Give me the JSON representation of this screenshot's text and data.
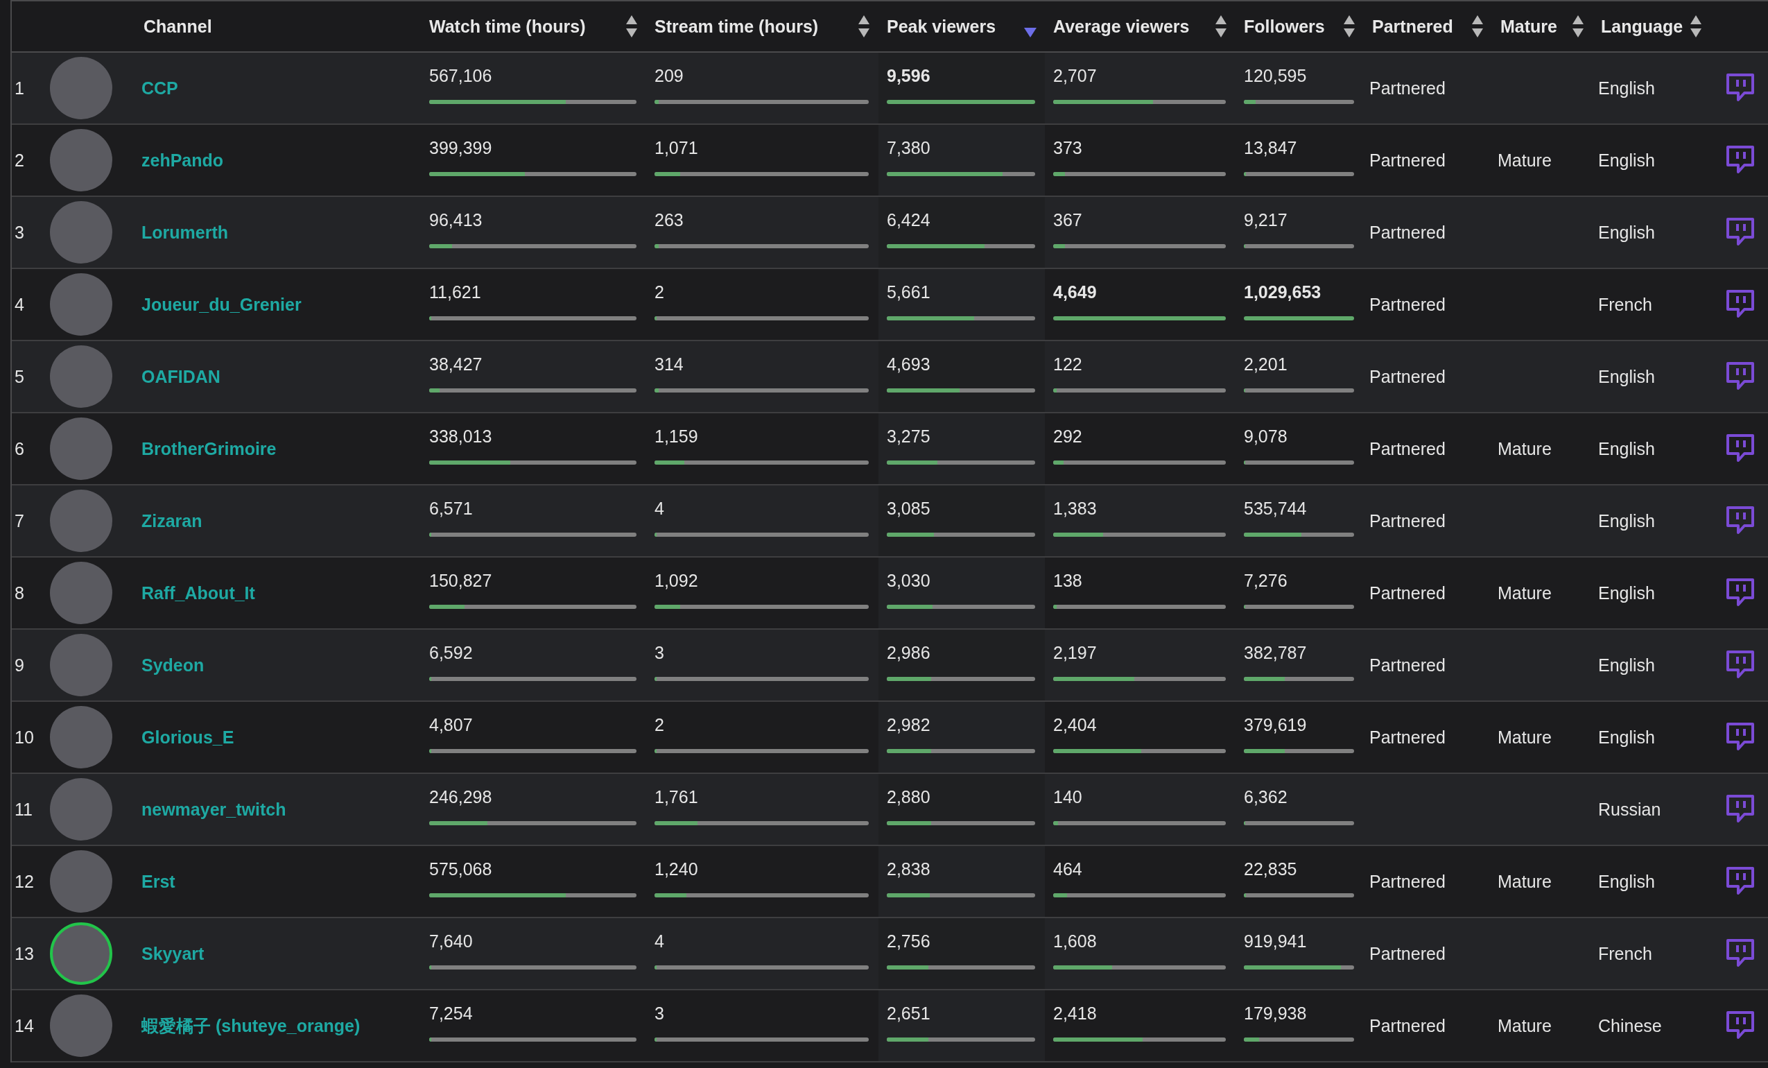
{
  "table": {
    "columns": [
      {
        "label": "Channel",
        "sortable": false
      },
      {
        "label": "Watch time (hours)",
        "sortable": true,
        "sorted": false
      },
      {
        "label": "Stream time (hours)",
        "sortable": true,
        "sorted": false
      },
      {
        "label": "Peak viewers",
        "sortable": true,
        "sorted": true
      },
      {
        "label": "Average viewers",
        "sortable": true,
        "sorted": false
      },
      {
        "label": "Followers",
        "sortable": true,
        "sorted": false
      },
      {
        "label": "Partnered",
        "sortable": true,
        "sorted": false
      },
      {
        "label": "Mature",
        "sortable": true,
        "sorted": false
      },
      {
        "label": "Language",
        "sortable": true,
        "sorted": false
      }
    ],
    "rows": [
      {
        "rank": "1",
        "channel": "CCP",
        "live": false,
        "metrics": [
          {
            "value": "567,106",
            "level": 0.66,
            "bold": false
          },
          {
            "value": "209",
            "level": 0.02,
            "bold": false
          },
          {
            "value": "9,596",
            "level": 1.0,
            "bold": true
          },
          {
            "value": "2,707",
            "level": 0.58,
            "bold": false
          },
          {
            "value": "120,595",
            "level": 0.11,
            "bold": false
          }
        ],
        "partnered": "Partnered",
        "language": "English"
      },
      {
        "rank": "2",
        "channel": "zehPando",
        "live": false,
        "metrics": [
          {
            "value": "399,399",
            "level": 0.46,
            "bold": false
          },
          {
            "value": "1,071",
            "level": 0.12,
            "bold": false
          },
          {
            "value": "7,380",
            "level": 0.78,
            "bold": false
          },
          {
            "value": "373",
            "level": 0.07,
            "bold": false
          },
          {
            "value": "13,847",
            "level": 0.02,
            "bold": false
          }
        ],
        "partnered": "Partnered",
        "mature": "Mature",
        "language": "English"
      },
      {
        "rank": "3",
        "channel": "Lorumerth",
        "live": false,
        "metrics": [
          {
            "value": "96,413",
            "level": 0.11,
            "bold": false
          },
          {
            "value": "263",
            "level": 0.02,
            "bold": false
          },
          {
            "value": "6,424",
            "level": 0.66,
            "bold": false
          },
          {
            "value": "367",
            "level": 0.07,
            "bold": false
          },
          {
            "value": "9,217",
            "level": 0.01,
            "bold": false
          }
        ],
        "partnered": "Partnered",
        "language": "English"
      },
      {
        "rank": "4",
        "channel": "Joueur_du_Grenier",
        "live": false,
        "metrics": [
          {
            "value": "11,621",
            "level": 0.01,
            "bold": false
          },
          {
            "value": "2",
            "level": 0.01,
            "bold": false
          },
          {
            "value": "5,661",
            "level": 0.59,
            "bold": false
          },
          {
            "value": "4,649",
            "level": 1.0,
            "bold": true
          },
          {
            "value": "1,029,653",
            "level": 1.0,
            "bold": true
          }
        ],
        "partnered": "Partnered",
        "language": "French"
      },
      {
        "rank": "5",
        "channel": "OAFIDAN",
        "live": false,
        "metrics": [
          {
            "value": "38,427",
            "level": 0.05,
            "bold": false
          },
          {
            "value": "314",
            "level": 0.02,
            "bold": false
          },
          {
            "value": "4,693",
            "level": 0.49,
            "bold": false
          },
          {
            "value": "122",
            "level": 0.02,
            "bold": false
          },
          {
            "value": "2,201",
            "level": 0.01,
            "bold": false
          }
        ],
        "partnered": "Partnered",
        "language": "English"
      },
      {
        "rank": "6",
        "channel": "BrotherGrimoire",
        "live": false,
        "metrics": [
          {
            "value": "338,013",
            "level": 0.39,
            "bold": false
          },
          {
            "value": "1,159",
            "level": 0.14,
            "bold": false
          },
          {
            "value": "3,275",
            "level": 0.34,
            "bold": false
          },
          {
            "value": "292",
            "level": 0.06,
            "bold": false
          },
          {
            "value": "9,078",
            "level": 0.01,
            "bold": false
          }
        ],
        "partnered": "Partnered",
        "mature": "Mature",
        "language": "English"
      },
      {
        "rank": "7",
        "channel": "Zizaran",
        "live": false,
        "metrics": [
          {
            "value": "6,571",
            "level": 0.01,
            "bold": false
          },
          {
            "value": "4",
            "level": 0.01,
            "bold": false
          },
          {
            "value": "3,085",
            "level": 0.32,
            "bold": false
          },
          {
            "value": "1,383",
            "level": 0.29,
            "bold": false
          },
          {
            "value": "535,744",
            "level": 0.52,
            "bold": false
          }
        ],
        "partnered": "Partnered",
        "language": "English"
      },
      {
        "rank": "8",
        "channel": "Raff_About_It",
        "live": false,
        "metrics": [
          {
            "value": "150,827",
            "level": 0.17,
            "bold": false
          },
          {
            "value": "1,092",
            "level": 0.12,
            "bold": false
          },
          {
            "value": "3,030",
            "level": 0.31,
            "bold": false
          },
          {
            "value": "138",
            "level": 0.02,
            "bold": false
          },
          {
            "value": "7,276",
            "level": 0.01,
            "bold": false
          }
        ],
        "partnered": "Partnered",
        "mature": "Mature",
        "language": "English"
      },
      {
        "rank": "9",
        "channel": "Sydeon",
        "live": false,
        "metrics": [
          {
            "value": "6,592",
            "level": 0.01,
            "bold": false
          },
          {
            "value": "3",
            "level": 0.01,
            "bold": false
          },
          {
            "value": "2,986",
            "level": 0.3,
            "bold": false
          },
          {
            "value": "2,197",
            "level": 0.47,
            "bold": false
          },
          {
            "value": "382,787",
            "level": 0.37,
            "bold": false
          }
        ],
        "partnered": "Partnered",
        "language": "English"
      },
      {
        "rank": "10",
        "channel": "Glorious_E",
        "live": false,
        "metrics": [
          {
            "value": "4,807",
            "level": 0.01,
            "bold": false
          },
          {
            "value": "2",
            "level": 0.01,
            "bold": false
          },
          {
            "value": "2,982",
            "level": 0.3,
            "bold": false
          },
          {
            "value": "2,404",
            "level": 0.51,
            "bold": false
          },
          {
            "value": "379,619",
            "level": 0.37,
            "bold": false
          }
        ],
        "partnered": "Partnered",
        "mature": "Mature",
        "language": "English"
      },
      {
        "rank": "11",
        "channel": "newmayer_twitch",
        "live": false,
        "metrics": [
          {
            "value": "246,298",
            "level": 0.28,
            "bold": false
          },
          {
            "value": "1,761",
            "level": 0.2,
            "bold": false
          },
          {
            "value": "2,880",
            "level": 0.3,
            "bold": false
          },
          {
            "value": "140",
            "level": 0.03,
            "bold": false
          },
          {
            "value": "6,362",
            "level": 0.01,
            "bold": false
          }
        ],
        "language": "Russian"
      },
      {
        "rank": "12",
        "channel": "Erst",
        "live": false,
        "metrics": [
          {
            "value": "575,068",
            "level": 0.66,
            "bold": false
          },
          {
            "value": "1,240",
            "level": 0.15,
            "bold": false
          },
          {
            "value": "2,838",
            "level": 0.29,
            "bold": false
          },
          {
            "value": "464",
            "level": 0.08,
            "bold": false
          },
          {
            "value": "22,835",
            "level": 0.02,
            "bold": false
          }
        ],
        "partnered": "Partnered",
        "mature": "Mature",
        "language": "English"
      },
      {
        "rank": "13",
        "channel": "Skyyart",
        "live": true,
        "metrics": [
          {
            "value": "7,640",
            "level": 0.01,
            "bold": false
          },
          {
            "value": "4",
            "level": 0.01,
            "bold": false
          },
          {
            "value": "2,756",
            "level": 0.28,
            "bold": false
          },
          {
            "value": "1,608",
            "level": 0.34,
            "bold": false
          },
          {
            "value": "919,941",
            "level": 0.88,
            "bold": false
          }
        ],
        "partnered": "Partnered",
        "language": "French"
      },
      {
        "rank": "14",
        "channel": "蝦愛橘子 (shuteye_orange)",
        "live": false,
        "metrics": [
          {
            "value": "7,254",
            "level": 0.01,
            "bold": false
          },
          {
            "value": "3",
            "level": 0.01,
            "bold": false
          },
          {
            "value": "2,651",
            "level": 0.28,
            "bold": false
          },
          {
            "value": "2,418",
            "level": 0.52,
            "bold": false
          },
          {
            "value": "179,938",
            "level": 0.14,
            "bold": false
          }
        ],
        "partnered": "Partnered",
        "mature": "Mature",
        "language": "Chinese"
      }
    ]
  }
}
